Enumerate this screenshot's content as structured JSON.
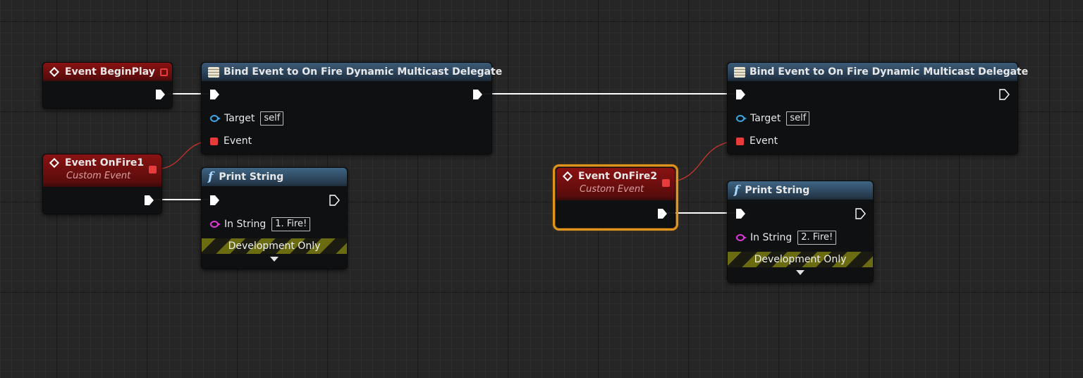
{
  "nodes": {
    "begin_play": {
      "title": "Event BeginPlay"
    },
    "bind1": {
      "title": "Bind Event to On Fire Dynamic Multicast Delegate",
      "target_label": "Target",
      "target_value": "self",
      "event_label": "Event"
    },
    "onfire1": {
      "title": "Event OnFire1",
      "subtitle": "Custom Event"
    },
    "print1": {
      "title": "Print String",
      "in_label": "In String",
      "in_value": "1. Fire!",
      "dev_label": "Development Only"
    },
    "bind2": {
      "title": "Bind Event to On Fire Dynamic Multicast Delegate",
      "target_label": "Target",
      "target_value": "self",
      "event_label": "Event"
    },
    "onfire2": {
      "title": "Event OnFire2",
      "subtitle": "Custom Event"
    },
    "print2": {
      "title": "Print String",
      "in_label": "In String",
      "in_value": "2. Fire!",
      "dev_label": "Development Only"
    }
  },
  "colors": {
    "exec_wire": "#ffffff",
    "delegate_wire": "#d0372b",
    "selection": "#e0941c",
    "event_header": "#8a1212",
    "bind_header": "#3c5b78",
    "function_header": "#3f6584"
  }
}
